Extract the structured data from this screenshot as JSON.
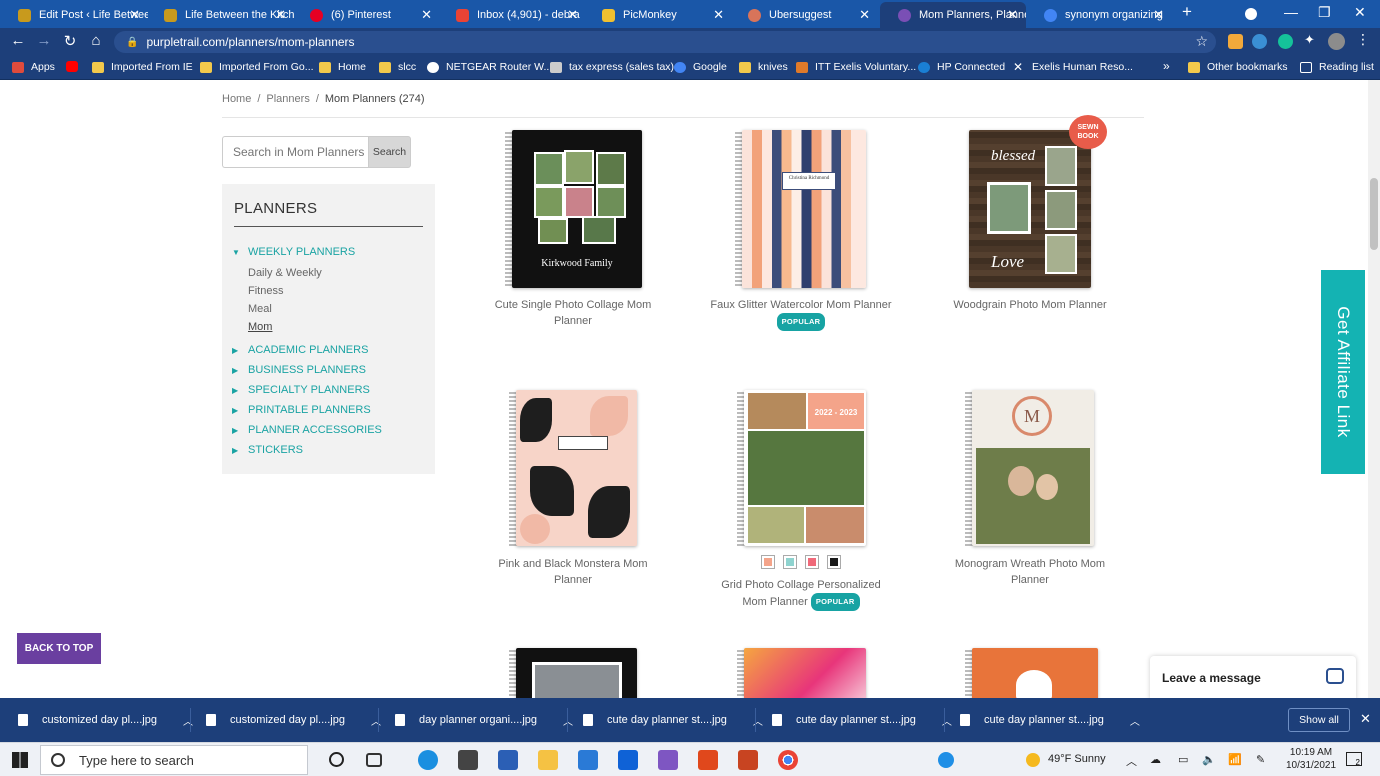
{
  "browser": {
    "tabs": [
      {
        "title": "Edit Post ‹ Life Between",
        "color": "#c89a1d"
      },
      {
        "title": "Life Between the Kitch",
        "color": "#c89a1d"
      },
      {
        "title": "(6) Pinterest",
        "color": "#e60023"
      },
      {
        "title": "Inbox (4,901) - debra",
        "color": "#ea4335"
      },
      {
        "title": "PicMonkey",
        "color": "#f0c030"
      },
      {
        "title": "Ubersuggest",
        "color": "#d8745a"
      },
      {
        "title": "Mom Planners, Planne",
        "color": "#7a4fb5"
      },
      {
        "title": "synonym organizing",
        "color": "#4285f4"
      }
    ],
    "new_tab": "+",
    "url": "purpletrail.com/planners/mom-planners",
    "bookmarks": [
      {
        "label": "Apps",
        "color": "#e04b3c"
      },
      {
        "label": "",
        "color": "#ff0000"
      },
      {
        "label": "Imported From IE",
        "color": "#f2c94c"
      },
      {
        "label": "Imported From Go...",
        "color": "#f2c94c"
      },
      {
        "label": "Home",
        "color": "#f2c94c"
      },
      {
        "label": "slcc",
        "color": "#f2c94c"
      },
      {
        "label": "NETGEAR Router W...",
        "color": "#ffffff"
      },
      {
        "label": "tax express (sales tax)",
        "color": "#cccccc"
      },
      {
        "label": "Google",
        "color": "#4285f4"
      },
      {
        "label": "knives",
        "color": "#f2c94c"
      },
      {
        "label": "ITT Exelis Voluntary...",
        "color": "#e07a2a"
      },
      {
        "label": "HP Connected",
        "color": "#1a7fd4"
      },
      {
        "label": "Exelis Human Reso...",
        "color": "#ffffff"
      },
      {
        "label": "»",
        "color": ""
      },
      {
        "label": "Other bookmarks",
        "color": "#f2c94c"
      },
      {
        "label": "Reading list",
        "color": "#ffffff"
      }
    ]
  },
  "breadcrumb": {
    "home": "Home",
    "sep": "/",
    "planners": "Planners",
    "current": "Mom Planners (274)"
  },
  "search": {
    "placeholder": "Search in Mom Planners",
    "button": "Search"
  },
  "sidebar": {
    "title": "PLANNERS",
    "expanded": {
      "label": "WEEKLY PLANNERS",
      "children": [
        "Daily & Weekly",
        "Fitness",
        "Meal",
        "Mom"
      ]
    },
    "categories": [
      "ACADEMIC PLANNERS",
      "BUSINESS PLANNERS",
      "SPECIALTY PLANNERS",
      "PRINTABLE PLANNERS",
      "PLANNER ACCESSORIES",
      "STICKERS"
    ]
  },
  "products": [
    {
      "name": "Cute Single Photo Collage Mom Planner",
      "badge": "",
      "cover_text": "Kirkwood Family"
    },
    {
      "name": "Faux Glitter Watercolor Mom Planner",
      "badge": "POPULAR",
      "cover_text": "Christina Richmond"
    },
    {
      "name": "Woodgrain Photo Mom Planner",
      "badge": "",
      "cover_text": "blessed",
      "ribbon": "SEWN BOOK"
    },
    {
      "name": "Pink and Black Monstera Mom Planner",
      "badge": "",
      "cover_text": ""
    },
    {
      "name": "Grid Photo Collage Personalized Mom Planner",
      "badge": "POPULAR",
      "cover_text": "2022 - 2023",
      "swatches": [
        "#f4a48a",
        "#8fd3cf",
        "#f06a7a",
        "#1a1a1a"
      ]
    },
    {
      "name": "Monogram Wreath Photo Mom Planner",
      "badge": "",
      "cover_text": "M"
    }
  ],
  "affiliate": "Get Affiliate Link",
  "back_to_top": "BACK TO TOP",
  "chat": "Leave a message",
  "downloads": {
    "items": [
      "customized day pl....jpg",
      "customized day pl....jpg",
      "day planner organi....jpg",
      "cute day planner st....jpg",
      "cute day planner st....jpg",
      "cute day planner st....jpg"
    ],
    "show_all": "Show all"
  },
  "taskbar": {
    "search_placeholder": "Type here to search",
    "weather": "49°F  Sunny",
    "time": "10:19 AM",
    "date": "10/31/2021",
    "notifications": "2"
  }
}
